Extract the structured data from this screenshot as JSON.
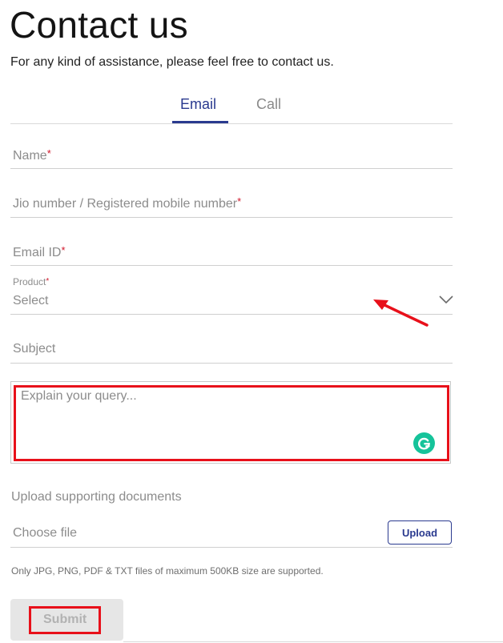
{
  "page": {
    "title": "Contact us",
    "subtitle": "For any kind of assistance, please feel free to contact us."
  },
  "tabs": [
    {
      "label": "Email",
      "active": true
    },
    {
      "label": "Call",
      "active": false
    }
  ],
  "form": {
    "name_placeholder": "Name",
    "mobile_placeholder": "Jio number / Registered mobile number",
    "email_placeholder": "Email ID",
    "required_marker": "*",
    "product_label": "Product",
    "product_selected": "Select",
    "subject_placeholder": "Subject",
    "query_placeholder": "Explain your query...",
    "upload_heading": "Upload supporting documents",
    "choose_file_label": "Choose file",
    "upload_button": "Upload",
    "upload_note": "Only JPG, PNG, PDF & TXT files of maximum 500KB size are supported.",
    "submit_button": "Submit"
  },
  "icons": {
    "dropdown": "chevron-down-icon",
    "grammarly": "grammarly-icon",
    "annotation": "red-arrow-annotation"
  },
  "colors": {
    "accent": "#2a3a8f",
    "required": "#d0162a",
    "highlight": "#e8101a",
    "grammarly": "#15c39a"
  }
}
